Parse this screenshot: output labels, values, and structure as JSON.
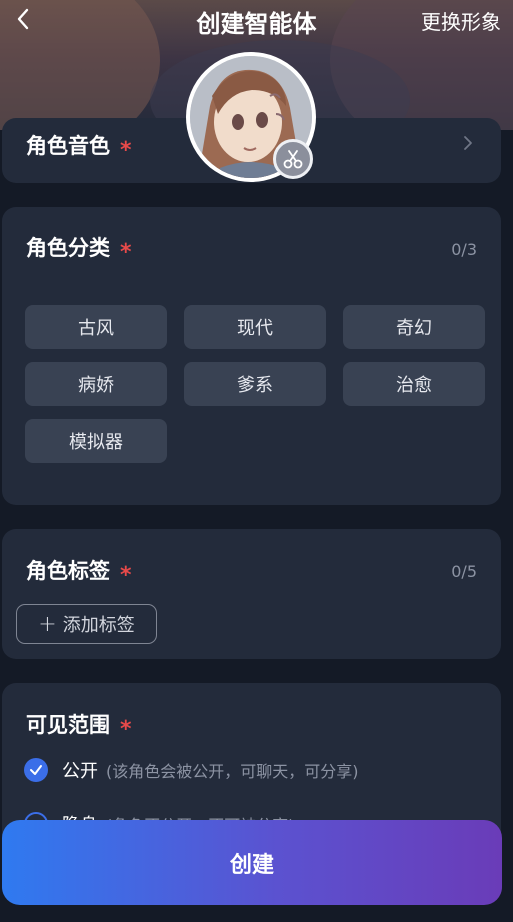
{
  "header": {
    "title": "创建智能体",
    "right_action": "更换形象",
    "back_icon": "chevron-left-icon"
  },
  "avatar": {
    "edit_icon": "scissors-icon"
  },
  "voice_section": {
    "label": "角色音色",
    "required_mark": "*",
    "chevron_icon": "chevron-right-icon"
  },
  "category_section": {
    "label": "角色分类",
    "required_mark": "*",
    "counter": "0/3",
    "options": [
      "古风",
      "现代",
      "奇幻",
      "病娇",
      "爹系",
      "治愈",
      "模拟器"
    ]
  },
  "tag_section": {
    "label": "角色标签",
    "required_mark": "*",
    "counter": "0/5",
    "add_icon": "plus-icon",
    "add_button": "添加标签"
  },
  "visibility_section": {
    "label": "可见范围",
    "required_mark": "*",
    "options": [
      {
        "label": "公开",
        "description": "(该角色会被公开，可聊天，可分享)",
        "selected": true
      },
      {
        "label": "隐身",
        "description": "(角色不公开，不可被分享)",
        "selected": false
      }
    ]
  },
  "create_button": "创建",
  "colors": {
    "background": "#141a26",
    "card": "#232b3b",
    "chip": "#394253",
    "required": "#e84a4a",
    "accent": "#3b6ee8",
    "button_gradient_start": "#2f7af0",
    "button_gradient_end": "#6a3cb8"
  }
}
